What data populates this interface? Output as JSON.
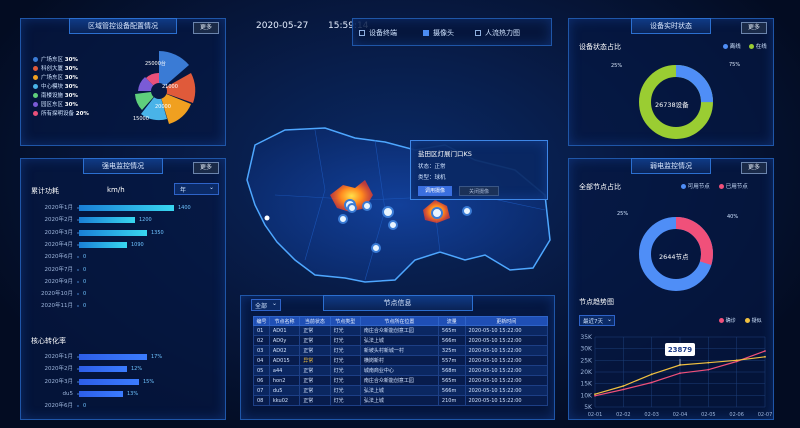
{
  "header": {
    "date": "2020-05-27",
    "time": "15:59:14"
  },
  "layers": [
    {
      "label": "设备终端",
      "checked": false
    },
    {
      "label": "摄像头",
      "checked": true
    },
    {
      "label": "人流热力图",
      "checked": false
    }
  ],
  "more_label": "更多",
  "panel_config": {
    "title": "区域管控设备配置情况",
    "legend": [
      {
        "label": "广场东区",
        "pct": "30%",
        "color": "#3a7bd5"
      },
      {
        "label": "科创大厦",
        "pct": "30%",
        "color": "#e05a3a"
      },
      {
        "label": "广场东区",
        "pct": "30%",
        "color": "#f0a020"
      },
      {
        "label": "中心模块",
        "pct": "30%",
        "color": "#49b3e8"
      },
      {
        "label": "南楼设施",
        "pct": "30%",
        "color": "#5fcf7c"
      },
      {
        "label": "园区东区",
        "pct": "30%",
        "color": "#7a5bd6"
      },
      {
        "label": "所有探明设备",
        "pct": "20%",
        "color": "#e8507a"
      }
    ],
    "rose_labels": [
      "25000台",
      "21000",
      "20000",
      "15000"
    ]
  },
  "panel_power": {
    "title": "强电监控情况",
    "sub1": "累计功耗",
    "unit": "km/h",
    "year_select": "年",
    "sub2": "核心转化率",
    "rows": [
      {
        "label": "2020年1月",
        "value": "1400",
        "frac": 0.95
      },
      {
        "label": "2020年2月",
        "value": "1200",
        "frac": 0.56
      },
      {
        "label": "2020年3月",
        "value": "1350",
        "frac": 0.68
      },
      {
        "label": "2020年4月",
        "value": "1090",
        "frac": 0.48
      },
      {
        "label": "2020年6月",
        "value": "0",
        "frac": 0
      },
      {
        "label": "2020年7月",
        "value": "0",
        "frac": 0
      },
      {
        "label": "2020年9月",
        "value": "0",
        "frac": 0
      },
      {
        "label": "2020年10月",
        "value": "0",
        "frac": 0
      },
      {
        "label": "2020年11月",
        "value": "0",
        "frac": 0
      }
    ],
    "rows2": [
      {
        "label": "2020年1月",
        "value": "17%",
        "frac": 0.68
      },
      {
        "label": "2020年2月",
        "value": "12%",
        "frac": 0.48
      },
      {
        "label": "2020年3月",
        "value": "15%",
        "frac": 0.6
      },
      {
        "label": "du5",
        "value": "13%",
        "frac": 0.44
      },
      {
        "label": "2020年6月",
        "value": "0",
        "frac": 0
      }
    ]
  },
  "popup": {
    "title": "盐田区灯展门口KS",
    "status_label": "状态：",
    "status": "正常",
    "type_label": "类型：",
    "type": "球机",
    "btn_call": "调用摄像",
    "btn_close": "关闭摄像"
  },
  "node_info": {
    "title": "节点信息",
    "filter": "全部",
    "columns": [
      "编号",
      "节点名称",
      "当前状态",
      "节点类型",
      "节点所在位置",
      "流量",
      "更新时间"
    ],
    "rows": [
      [
        "01",
        "AD01",
        "正常",
        "灯光",
        "南庄合众新能创意工园",
        "565m",
        "2020-05-10 15:22:00"
      ],
      [
        "02",
        "AD0y",
        "正常",
        "灯光",
        "弘法上城",
        "566m",
        "2020-05-10 15:22:00"
      ],
      [
        "03",
        "AD02",
        "正常",
        "灯光",
        "新坡头村新城一村",
        "325m",
        "2020-05-10 15:22:00"
      ],
      [
        "04",
        "AD015",
        "异常",
        "灯光",
        "横岗新村",
        "557m",
        "2020-05-10 15:22:00"
      ],
      [
        "05",
        "a44",
        "正常",
        "灯光",
        "城南商业中心",
        "568m",
        "2020-05-10 15:22:00"
      ],
      [
        "06",
        "hon2",
        "正常",
        "灯光",
        "南庄合众新能创意工园",
        "565m",
        "2020-05-10 15:22:00"
      ],
      [
        "07",
        "du5",
        "正常",
        "灯光",
        "弘法上城",
        "566m",
        "2020-05-10 15:22:00"
      ],
      [
        "08",
        "kku02",
        "正常",
        "灯光",
        "弘法上城",
        "210m",
        "2020-05-10 15:22:00"
      ]
    ]
  },
  "panel_status": {
    "title": "设备实时状态",
    "sub": "设备状态占比",
    "legend": [
      {
        "label": "离线",
        "color": "#4f8ef7"
      },
      {
        "label": "在线",
        "color": "#9acd32"
      }
    ],
    "center": "26738设备",
    "pct_left": "25%",
    "pct_right": "75%"
  },
  "panel_weak": {
    "title": "弱电监控情况",
    "sub": "全部节点占比",
    "legend": [
      {
        "label": "可用节点",
        "color": "#4f8ef7"
      },
      {
        "label": "已用节点",
        "color": "#f0507a"
      }
    ],
    "center": "2644节点",
    "pct_left": "25%",
    "pct_right": "40%",
    "trend_title": "节点趋势图",
    "range_select": "最近7天",
    "trend_legend": [
      {
        "label": "确诊",
        "color": "#f0507a"
      },
      {
        "label": "疑似",
        "color": "#f0c040"
      }
    ],
    "tooltip": "23879"
  },
  "chart_data": {
    "type": "line",
    "title": "节点趋势图",
    "x": [
      "02-01",
      "02-02",
      "02-03",
      "02-04",
      "02-05",
      "02-06",
      "02-07"
    ],
    "yticks": [
      "35K",
      "30K",
      "25K",
      "20K",
      "15K",
      "10K",
      "5K"
    ],
    "ylim": [
      5000,
      35000
    ],
    "series": [
      {
        "name": "确诊",
        "color": "#f0507a",
        "values": [
          9800,
          12500,
          15500,
          19500,
          21000,
          24500,
          29000
        ]
      },
      {
        "name": "疑似",
        "color": "#f0c040",
        "values": [
          10500,
          14000,
          19000,
          23000,
          24000,
          25000,
          26500
        ]
      }
    ],
    "tooltip_value": "23879"
  }
}
